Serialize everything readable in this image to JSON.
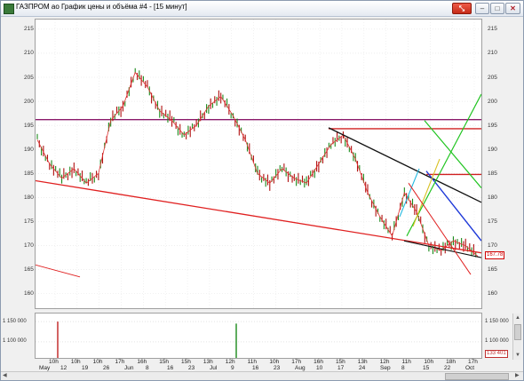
{
  "window": {
    "title": "ГАЗПРОМ ao График цены и объёма #4 - [15 минут]",
    "controls": {
      "pin": "⤡",
      "minimize": "–",
      "maximize": "□",
      "close": "✕"
    },
    "icons": {
      "app": "chart-icon",
      "pin": "pin-icon",
      "minimize": "minimize-icon",
      "maximize": "maximize-icon",
      "close": "close-icon"
    },
    "accent_color": "#d8341f"
  },
  "price_axis": {
    "labels": [
      "215",
      "210",
      "205",
      "200",
      "195",
      "190",
      "185",
      "180",
      "175",
      "170",
      "165",
      "160"
    ],
    "current_price": "167.78"
  },
  "volume_axis": {
    "labels": [
      "1 150 000",
      "1 100 000"
    ],
    "current_volume": "133 401"
  },
  "time_axis": {
    "hour_labels": [
      "10h",
      "10h",
      "10h",
      "17h",
      "16h",
      "15h",
      "15h",
      "13h",
      "12h",
      "11h",
      "10h",
      "17h",
      "16h",
      "15h",
      "13h",
      "12h",
      "11h",
      "10h",
      "18h",
      "17h"
    ],
    "date_labels": [
      "May",
      "12",
      "19",
      "26",
      "Jun",
      "8",
      "16",
      "23",
      "Jul",
      "9",
      "16",
      "23",
      "Aug",
      "10",
      "17",
      "24",
      "Sep",
      "8",
      "15",
      "22",
      "Oct"
    ]
  },
  "chart_data": {
    "type": "line",
    "title": "",
    "series": [
      {
        "values": [
          192,
          187,
          184,
          186,
          183,
          185,
          196,
          199,
          206,
          203,
          198,
          196,
          193,
          195,
          199,
          201,
          197,
          192,
          185,
          183,
          186,
          184,
          183,
          187,
          191,
          193,
          188,
          181,
          176,
          172,
          181,
          177,
          170,
          169,
          171,
          170,
          167.78
        ]
      }
    ],
    "ylim": [
      157,
      217
    ],
    "horizontal_levels": [
      196.2,
      194.3,
      184.8
    ],
    "grid": true,
    "volume_ylim": [
      1060000,
      1170000
    ]
  }
}
